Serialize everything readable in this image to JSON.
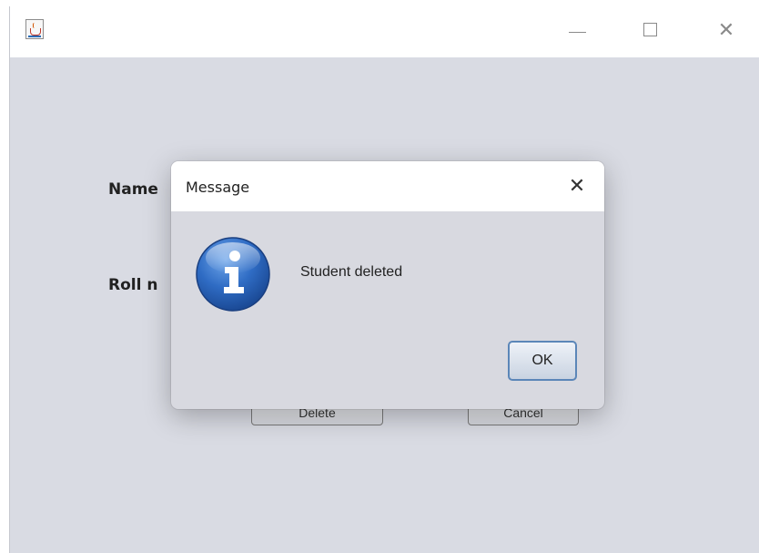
{
  "window": {
    "title": "",
    "controls": {
      "minimize_icon": "minimize-icon",
      "maximize_icon": "maximize-icon",
      "close_label": "✕"
    }
  },
  "form": {
    "name_label": "Name",
    "roll_label": "Roll n",
    "delete_button_label": "Delete",
    "cancel_button_label": "Cancel"
  },
  "dialog": {
    "title": "Message",
    "close_label": "✕",
    "message": "Student deleted",
    "ok_label": "OK",
    "icon": "info-icon"
  },
  "colors": {
    "window_bg": "#d9dbe3",
    "dialog_bg": "#d8d9e0",
    "info_icon_blue": "#2a62b8",
    "ok_border": "#5b86b8"
  }
}
